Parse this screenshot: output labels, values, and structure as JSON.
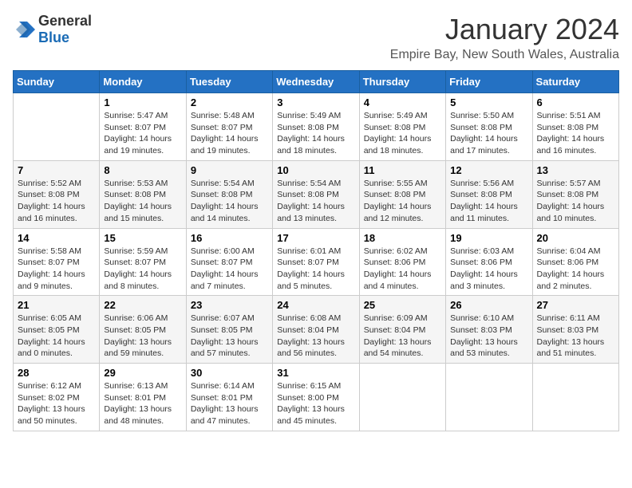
{
  "logo": {
    "general": "General",
    "blue": "Blue"
  },
  "header": {
    "month": "January 2024",
    "location": "Empire Bay, New South Wales, Australia"
  },
  "weekdays": [
    "Sunday",
    "Monday",
    "Tuesday",
    "Wednesday",
    "Thursday",
    "Friday",
    "Saturday"
  ],
  "weeks": [
    [
      {
        "day": "",
        "content": ""
      },
      {
        "day": "1",
        "content": "Sunrise: 5:47 AM\nSunset: 8:07 PM\nDaylight: 14 hours\nand 19 minutes."
      },
      {
        "day": "2",
        "content": "Sunrise: 5:48 AM\nSunset: 8:07 PM\nDaylight: 14 hours\nand 19 minutes."
      },
      {
        "day": "3",
        "content": "Sunrise: 5:49 AM\nSunset: 8:08 PM\nDaylight: 14 hours\nand 18 minutes."
      },
      {
        "day": "4",
        "content": "Sunrise: 5:49 AM\nSunset: 8:08 PM\nDaylight: 14 hours\nand 18 minutes."
      },
      {
        "day": "5",
        "content": "Sunrise: 5:50 AM\nSunset: 8:08 PM\nDaylight: 14 hours\nand 17 minutes."
      },
      {
        "day": "6",
        "content": "Sunrise: 5:51 AM\nSunset: 8:08 PM\nDaylight: 14 hours\nand 16 minutes."
      }
    ],
    [
      {
        "day": "7",
        "content": "Sunrise: 5:52 AM\nSunset: 8:08 PM\nDaylight: 14 hours\nand 16 minutes."
      },
      {
        "day": "8",
        "content": "Sunrise: 5:53 AM\nSunset: 8:08 PM\nDaylight: 14 hours\nand 15 minutes."
      },
      {
        "day": "9",
        "content": "Sunrise: 5:54 AM\nSunset: 8:08 PM\nDaylight: 14 hours\nand 14 minutes."
      },
      {
        "day": "10",
        "content": "Sunrise: 5:54 AM\nSunset: 8:08 PM\nDaylight: 14 hours\nand 13 minutes."
      },
      {
        "day": "11",
        "content": "Sunrise: 5:55 AM\nSunset: 8:08 PM\nDaylight: 14 hours\nand 12 minutes."
      },
      {
        "day": "12",
        "content": "Sunrise: 5:56 AM\nSunset: 8:08 PM\nDaylight: 14 hours\nand 11 minutes."
      },
      {
        "day": "13",
        "content": "Sunrise: 5:57 AM\nSunset: 8:08 PM\nDaylight: 14 hours\nand 10 minutes."
      }
    ],
    [
      {
        "day": "14",
        "content": "Sunrise: 5:58 AM\nSunset: 8:07 PM\nDaylight: 14 hours\nand 9 minutes."
      },
      {
        "day": "15",
        "content": "Sunrise: 5:59 AM\nSunset: 8:07 PM\nDaylight: 14 hours\nand 8 minutes."
      },
      {
        "day": "16",
        "content": "Sunrise: 6:00 AM\nSunset: 8:07 PM\nDaylight: 14 hours\nand 7 minutes."
      },
      {
        "day": "17",
        "content": "Sunrise: 6:01 AM\nSunset: 8:07 PM\nDaylight: 14 hours\nand 5 minutes."
      },
      {
        "day": "18",
        "content": "Sunrise: 6:02 AM\nSunset: 8:06 PM\nDaylight: 14 hours\nand 4 minutes."
      },
      {
        "day": "19",
        "content": "Sunrise: 6:03 AM\nSunset: 8:06 PM\nDaylight: 14 hours\nand 3 minutes."
      },
      {
        "day": "20",
        "content": "Sunrise: 6:04 AM\nSunset: 8:06 PM\nDaylight: 14 hours\nand 2 minutes."
      }
    ],
    [
      {
        "day": "21",
        "content": "Sunrise: 6:05 AM\nSunset: 8:05 PM\nDaylight: 14 hours\nand 0 minutes."
      },
      {
        "day": "22",
        "content": "Sunrise: 6:06 AM\nSunset: 8:05 PM\nDaylight: 13 hours\nand 59 minutes."
      },
      {
        "day": "23",
        "content": "Sunrise: 6:07 AM\nSunset: 8:05 PM\nDaylight: 13 hours\nand 57 minutes."
      },
      {
        "day": "24",
        "content": "Sunrise: 6:08 AM\nSunset: 8:04 PM\nDaylight: 13 hours\nand 56 minutes."
      },
      {
        "day": "25",
        "content": "Sunrise: 6:09 AM\nSunset: 8:04 PM\nDaylight: 13 hours\nand 54 minutes."
      },
      {
        "day": "26",
        "content": "Sunrise: 6:10 AM\nSunset: 8:03 PM\nDaylight: 13 hours\nand 53 minutes."
      },
      {
        "day": "27",
        "content": "Sunrise: 6:11 AM\nSunset: 8:03 PM\nDaylight: 13 hours\nand 51 minutes."
      }
    ],
    [
      {
        "day": "28",
        "content": "Sunrise: 6:12 AM\nSunset: 8:02 PM\nDaylight: 13 hours\nand 50 minutes."
      },
      {
        "day": "29",
        "content": "Sunrise: 6:13 AM\nSunset: 8:01 PM\nDaylight: 13 hours\nand 48 minutes."
      },
      {
        "day": "30",
        "content": "Sunrise: 6:14 AM\nSunset: 8:01 PM\nDaylight: 13 hours\nand 47 minutes."
      },
      {
        "day": "31",
        "content": "Sunrise: 6:15 AM\nSunset: 8:00 PM\nDaylight: 13 hours\nand 45 minutes."
      },
      {
        "day": "",
        "content": ""
      },
      {
        "day": "",
        "content": ""
      },
      {
        "day": "",
        "content": ""
      }
    ]
  ]
}
